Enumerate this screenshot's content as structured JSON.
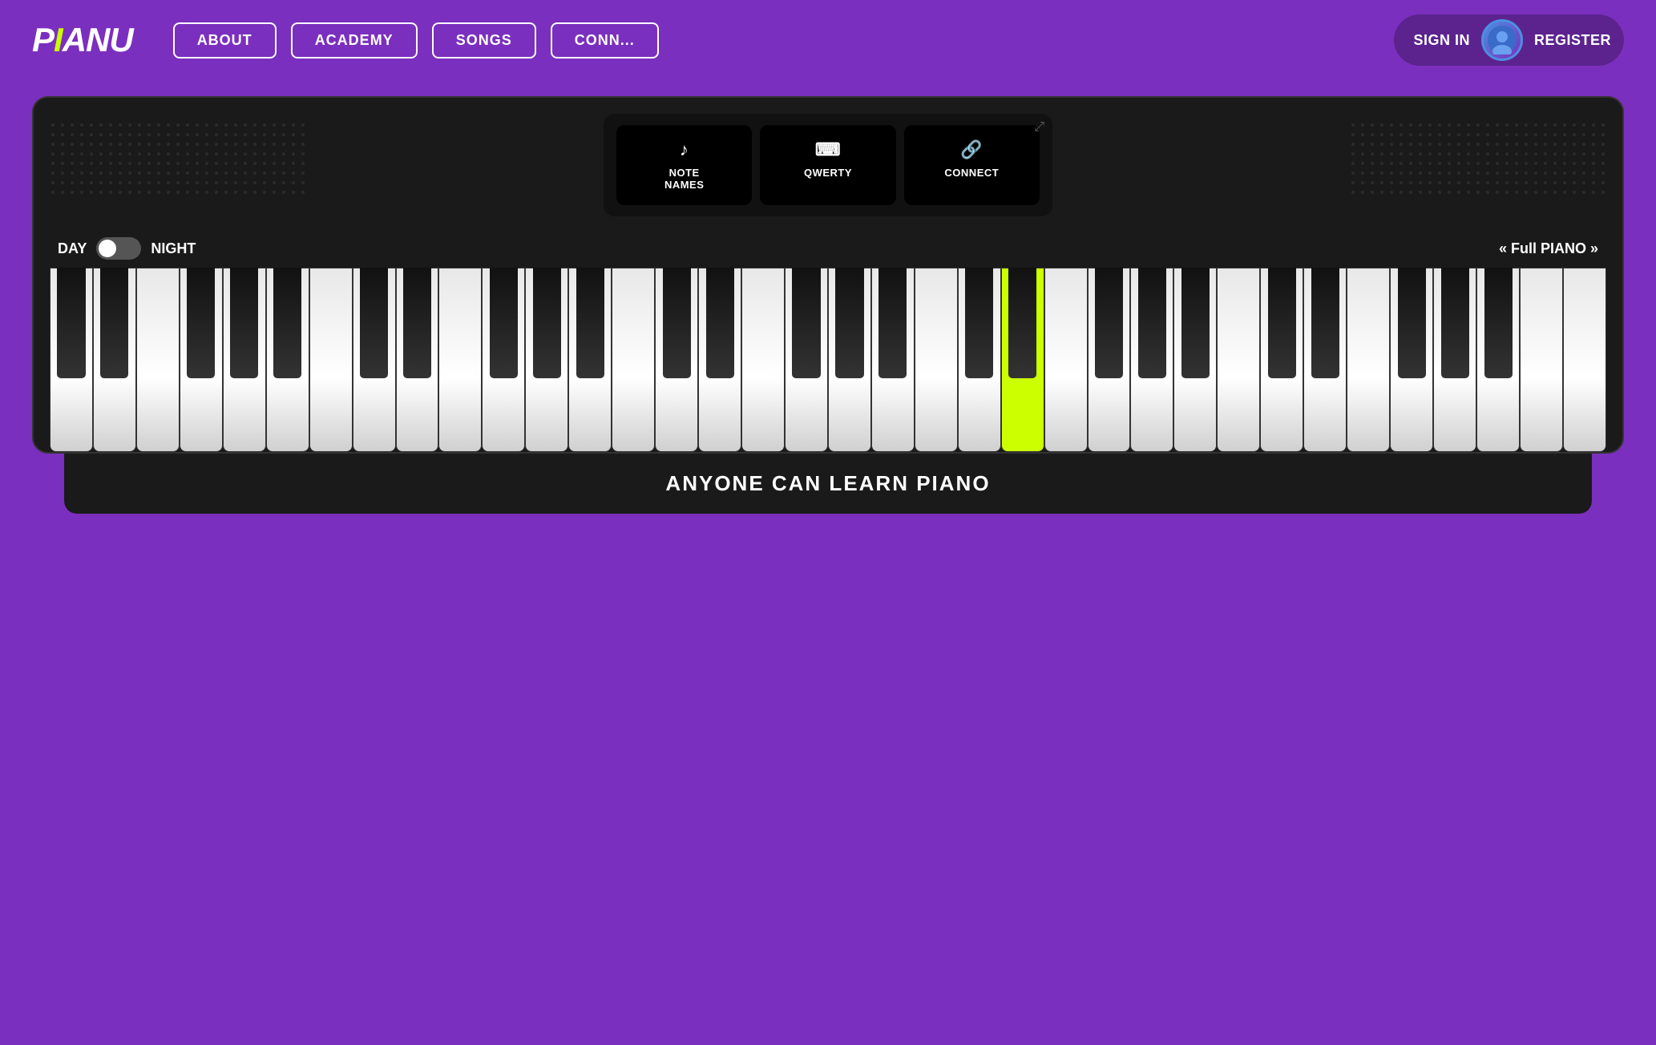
{
  "header": {
    "logo": "PiANU",
    "nav": [
      {
        "label": "ABOUT",
        "id": "about"
      },
      {
        "label": "ACADEMY",
        "id": "academy"
      },
      {
        "label": "SONGS",
        "id": "songs"
      },
      {
        "label": "CONN...",
        "id": "connect-nav"
      }
    ],
    "signIn": "SIGN IN",
    "register": "REGISTER"
  },
  "piano": {
    "controls": [
      {
        "id": "note-names",
        "icon": "♪",
        "label": "NOTE\nNAMES"
      },
      {
        "id": "qwerty",
        "icon": "⌨",
        "label": "QWERTY"
      },
      {
        "id": "connect",
        "icon": "🔗",
        "label": "CONNECT"
      }
    ],
    "dayLabel": "DAY",
    "nightLabel": "NIGHT",
    "fullPiano": "« Full PIANO »",
    "whiteKeys": 36,
    "highlightedKey": 22
  },
  "banner": {
    "text": "ANYONE CAN LEARN PIANO"
  },
  "colors": {
    "bg": "#7B2FBE",
    "pianoBody": "#1a1a1a",
    "highlight": "#CCFF00",
    "navBorder": "#ffffff"
  }
}
